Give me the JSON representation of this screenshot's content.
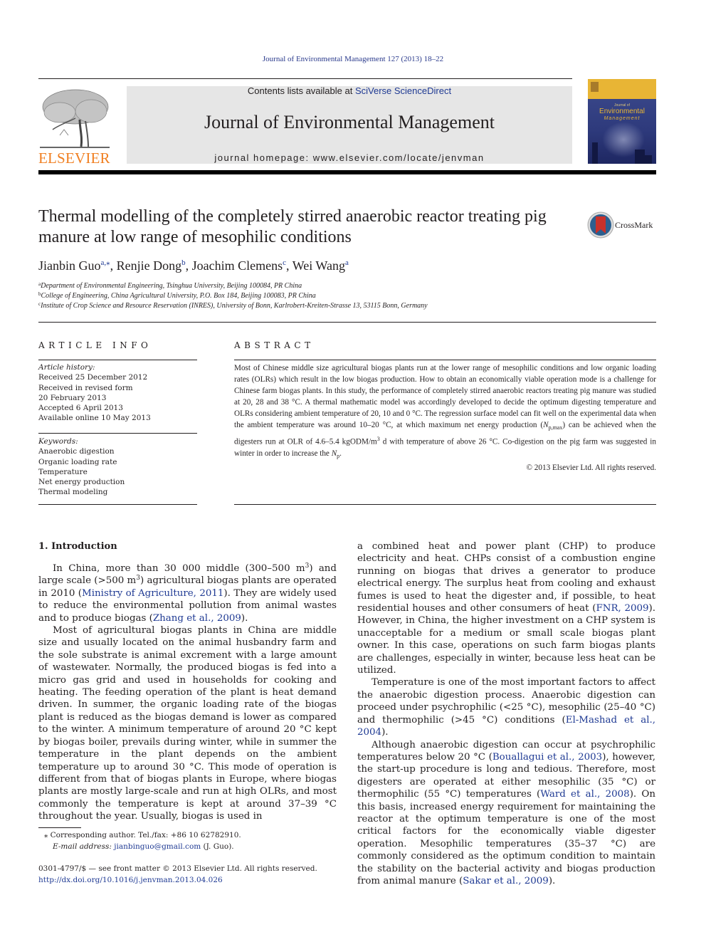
{
  "header": {
    "citation": "Journal of Environmental Management 127 (2013) 18–22",
    "contents_prefix": "Contents lists available at ",
    "contents_link": "SciVerse ScienceDirect",
    "journal_title": "Journal of Environmental Management",
    "homepage": "journal homepage: www.elsevier.com/locate/jenvman",
    "publisher_logo": "ELSEVIER",
    "cover": {
      "small": "Journal of",
      "title": "Environmental",
      "subtitle": "Management"
    },
    "colors": {
      "elsevier_orange": "#f07f21",
      "link_blue": "#1f3a93",
      "masthead_gray": "#e6e6e6",
      "cover_blue": "#2e3a7c",
      "cover_gold": "#e8b535"
    }
  },
  "article": {
    "title": "Thermal modelling of the completely stirred anaerobic reactor treating pig manure at low range of mesophilic conditions",
    "crossmark_label": "CrossMark",
    "authors": [
      {
        "name": "Jianbin Guo",
        "sup": "a,⁎",
        "sep": ", "
      },
      {
        "name": "Renjie Dong",
        "sup": "b",
        "sep": ", "
      },
      {
        "name": "Joachim Clemens",
        "sup": "c",
        "sep": ", "
      },
      {
        "name": "Wei Wang",
        "sup": "a",
        "sep": ""
      }
    ],
    "affiliations": [
      {
        "key": "a",
        "text": "Department of Environmental Engineering, Tsinghua University, Beijing 100084, PR China"
      },
      {
        "key": "b",
        "text": "College of Engineering, China Agricultural University, P.O. Box 184, Beijing 100083, PR China"
      },
      {
        "key": "c",
        "text": "Institute of Crop Science and Resource Reservation (INRES), University of Bonn, Karlrobert-Kreiten-Strasse 13, 53115 Bonn, Germany"
      }
    ]
  },
  "article_info": {
    "heading": "ARTICLE INFO",
    "history_label": "Article history:",
    "history": [
      "Received 25 December 2012",
      "Received in revised form",
      "20 February 2013",
      "Accepted 6 April 2013",
      "Available online 10 May 2013"
    ],
    "keywords_label": "Keywords:",
    "keywords": [
      "Anaerobic digestion",
      "Organic loading rate",
      "Temperature",
      "Net energy production",
      "Thermal modeling"
    ]
  },
  "abstract": {
    "heading": "ABSTRACT",
    "part1": "Most of Chinese middle size agricultural biogas plants run at the lower range of mesophilic conditions and low organic loading rates (OLRs) which result in the low biogas production. How to obtain an economically viable operation mode is a challenge for Chinese farm biogas plants. In this study, the performance of completely stirred anaerobic reactors treating pig manure was studied at 20, 28 and 38 °C. A thermal mathematic model was accordingly developed to decide the optimum digesting temperature and OLRs considering ambient temperature of 20, 10 and 0 °C. The regression surface model can fit well on the experimental data when the ambient temperature was around 10–20 °C, at which maximum net energy production (",
    "np_max": "N",
    "np_max_sub": "p,max",
    "part2": ") can be achieved when the digesters run at OLR of 4.6–5.4 kgODM/m",
    "part2_sup": "3",
    "part3": " d with temperature of above 26 °C. Co-digestion on the pig farm was suggested in winter in order to increase the ",
    "np": "N",
    "np_sub": "p",
    "part4": ".",
    "copyright": "© 2013 Elsevier Ltd. All rights reserved."
  },
  "body": {
    "section_heading": "1.  Introduction",
    "left": {
      "p1_a": "In China, more than 30 000 middle (300–500 m",
      "p1_sup1": "3",
      "p1_b": ") and large scale (>500 m",
      "p1_sup2": "3",
      "p1_c": ") agricultural biogas plants are operated in 2010 (",
      "p1_ref1": "Ministry of Agriculture, 2011",
      "p1_d": "). They are widely used to reduce the environmental pollution from animal wastes and to produce biogas (",
      "p1_ref2": "Zhang et al., 2009",
      "p1_e": ").",
      "p2": "Most of agricultural biogas plants in China are middle size and usually located on the animal husbandry farm and the sole substrate is animal excrement with a large amount of wastewater. Normally, the produced biogas is fed into a micro gas grid and used in households for cooking and heating. The feeding operation of the plant is heat demand driven. In summer, the organic loading rate of the biogas plant is reduced as the biogas demand is lower as compared to the winter. A minimum temperature of around 20 °C kept by biogas boiler, prevails during winter, while in summer the temperature in the plant depends on the ambient temperature up to around 30 °C. This mode of operation is different from that of biogas plants in Europe, where biogas plants are mostly large-scale and run at high OLRs, and most commonly the temperature is kept at around 37–39 °C throughout the year. Usually, biogas is used in"
    },
    "right": {
      "p1_a": "a combined heat and power plant (CHP) to produce electricity and heat. CHPs consist of a combustion engine running on biogas that drives a generator to produce electrical energy. The surplus heat from cooling and exhaust fumes is used to heat the digester and, if possible, to heat residential houses and other consumers of heat (",
      "p1_ref": "FNR, 2009",
      "p1_b": "). However, in China, the higher investment on a CHP system is unacceptable for a medium or small scale biogas plant owner. In this case, operations on such farm biogas plants are challenges, especially in winter, because less heat can be utilized.",
      "p2_a": "Temperature is one of the most important factors to affect the anaerobic digestion process. Anaerobic digestion can proceed under psychrophilic (<25 °C), mesophilic (25–40 °C) and thermophilic (>45 °C) conditions (",
      "p2_ref": "El-Mashad et al., 2004",
      "p2_b": ").",
      "p3_a": "Although anaerobic digestion can occur at psychrophilic temperatures below 20 °C (",
      "p3_ref1": "Bouallagui et al., 2003",
      "p3_b": "), however, the start-up procedure is long and tedious. Therefore, most digesters are operated at either mesophilic (35 °C) or thermophilic (55 °C) temperatures (",
      "p3_ref2": "Ward et al., 2008",
      "p3_c": "). On this basis, increased energy requirement for maintaining the reactor at the optimum temperature is one of the most critical factors for the economically viable digester operation. Mesophilic temperatures (35–37 °C) are commonly considered as the optimum condition to maintain the stability on the bacterial activity and biogas production from animal manure (",
      "p3_ref3": "Sakar et al., 2009",
      "p3_d": ")."
    }
  },
  "footer": {
    "corresponding": "⁎  Corresponding author. Tel./fax: +86 10 62782910.",
    "email_label": "E-mail address: ",
    "email": "jianbinguo@gmail.com",
    "email_suffix": " (J. Guo).",
    "issn": "0301-4797/$ — see front matter © 2013 Elsevier Ltd. All rights reserved.",
    "doi": "http://dx.doi.org/10.1016/j.jenvman.2013.04.026"
  }
}
